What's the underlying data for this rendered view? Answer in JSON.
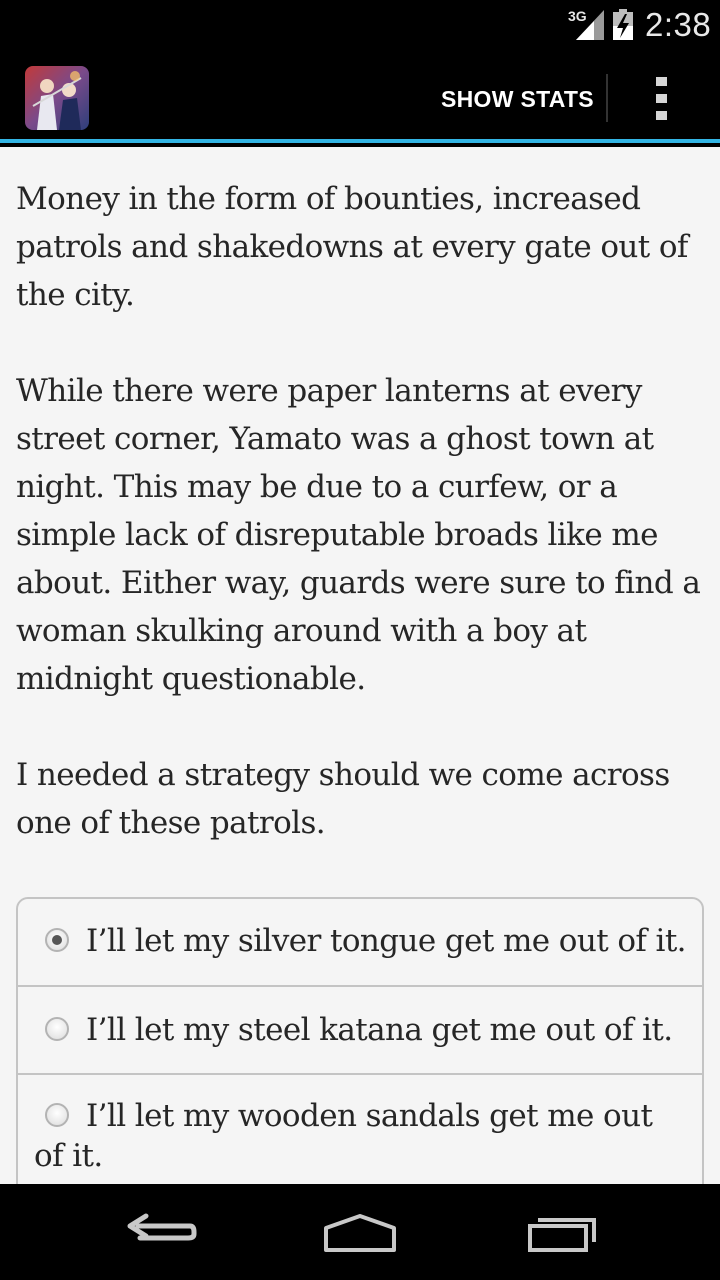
{
  "status_bar": {
    "network": "3G",
    "time": "2:38",
    "signal_icon": "signal-icon",
    "battery_icon": "battery-charging-icon"
  },
  "action_bar": {
    "app_icon": "app-icon",
    "show_stats_label": "SHOW STATS",
    "overflow_icon": "overflow-menu-icon",
    "accent_color": "#33b5e5"
  },
  "story": {
    "paragraphs": [
      "Money in the form of bounties, increased patrols and shakedowns at every gate out of the city.",
      "While there were paper lanterns at every street corner, Yamato was a ghost town at night. This may be due to a curfew, or a simple lack of disreputable broads like me about. Either way, guards were sure to find a woman skulking around with a boy at midnight questionable.",
      "I needed a strategy should we come across one of these patrols."
    ]
  },
  "choices": [
    {
      "label": "I’ll let my silver tongue get me out of it.",
      "selected": true
    },
    {
      "label": "I’ll let my steel katana get me out of it.",
      "selected": false
    },
    {
      "label": "I’ll let my wooden sandals get me out of it.",
      "selected": false
    }
  ],
  "nav_bar": {
    "back_icon": "back-icon",
    "home_icon": "home-icon",
    "recent_icon": "recent-apps-icon"
  }
}
